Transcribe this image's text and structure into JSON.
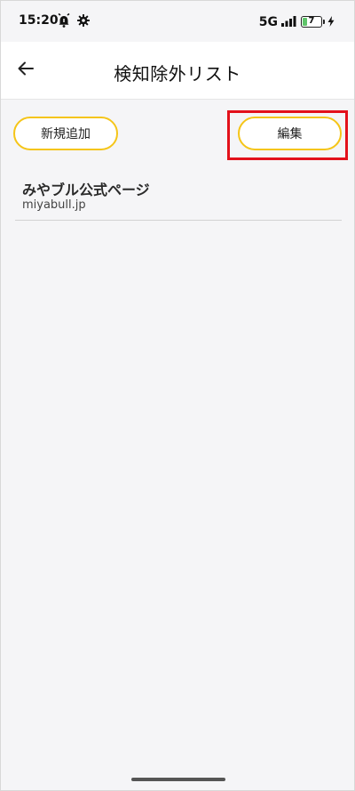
{
  "status_bar": {
    "time": "15:20",
    "left_icons": [
      "alarm-bell-icon",
      "gear-icon"
    ],
    "network": "5G",
    "battery_level": "7",
    "battery_fraction": 0.07
  },
  "header": {
    "title": "検知除外リスト",
    "back_icon": "arrow-left-icon"
  },
  "actions": {
    "add_label": "新規追加",
    "edit_label": "編集"
  },
  "list": {
    "items": [
      {
        "title": "みやブル公式ページ",
        "domain": "miyabull.jp"
      }
    ]
  },
  "colors": {
    "accent": "#f5c518",
    "highlight": "#e3111b",
    "background": "#f5f5f7"
  }
}
